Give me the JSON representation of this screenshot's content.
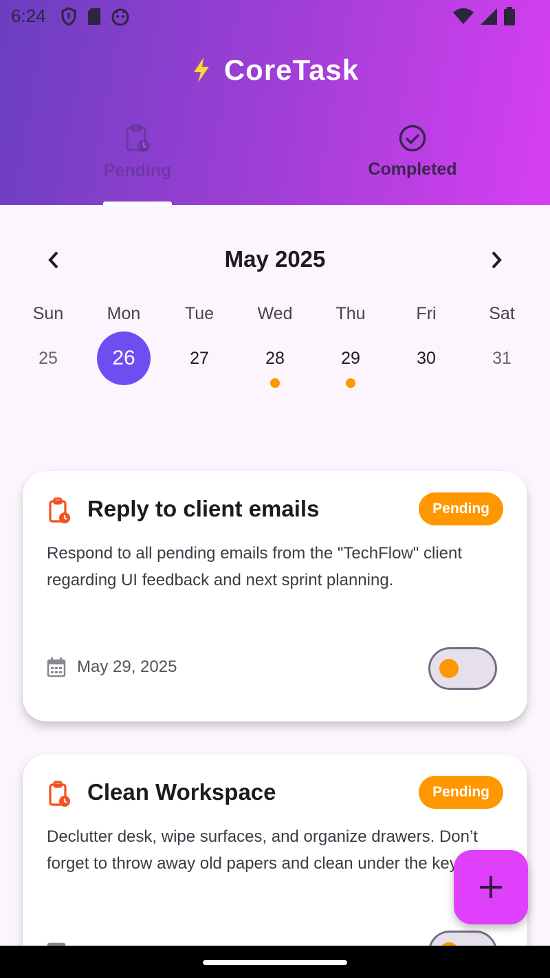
{
  "status_bar": {
    "time": "6:24",
    "left_icons": [
      "shield-icon",
      "sd-card-icon",
      "face-icon"
    ],
    "right_icons": [
      "wifi-icon",
      "signal-icon",
      "battery-icon"
    ]
  },
  "header": {
    "app_title": "CoreTask",
    "logo_icon": "lightning-icon",
    "logo_color": "#FDD835",
    "tabs": [
      {
        "label": "Pending",
        "icon": "clipboard-clock-icon",
        "selected": true
      },
      {
        "label": "Completed",
        "icon": "check-circle-icon",
        "selected": false
      }
    ]
  },
  "calendar": {
    "month_label": "May 2025",
    "weekdays": [
      "Sun",
      "Mon",
      "Tue",
      "Wed",
      "Thu",
      "Fri",
      "Sat"
    ],
    "days": [
      "25",
      "26",
      "27",
      "28",
      "29",
      "30",
      "31"
    ],
    "selected_day": "26",
    "days_with_tasks": [
      "28",
      "29"
    ],
    "accent_color": "#6D4EF0",
    "dot_color": "#FF9800"
  },
  "tasks": [
    {
      "title": "Reply to client emails",
      "status": "Pending",
      "description": "Respond to all pending emails from the \"TechFlow\" client regarding UI feedback and next sprint planning.",
      "date": "May 29, 2025",
      "completed": false
    },
    {
      "title": "Clean Workspace",
      "status": "Pending",
      "description": "Declutter desk, wipe surfaces, and organize drawers. Don’t forget to throw away old papers and clean under the keyboard.",
      "date": "",
      "completed": false
    }
  ],
  "colors": {
    "status_badge": "#FF9800",
    "task_icon": "#F4511E",
    "fab": "#E040FB",
    "header_gradient_start": "#6A3FC0",
    "header_gradient_end": "#D73FF1"
  },
  "fab": {
    "icon": "plus-icon"
  }
}
